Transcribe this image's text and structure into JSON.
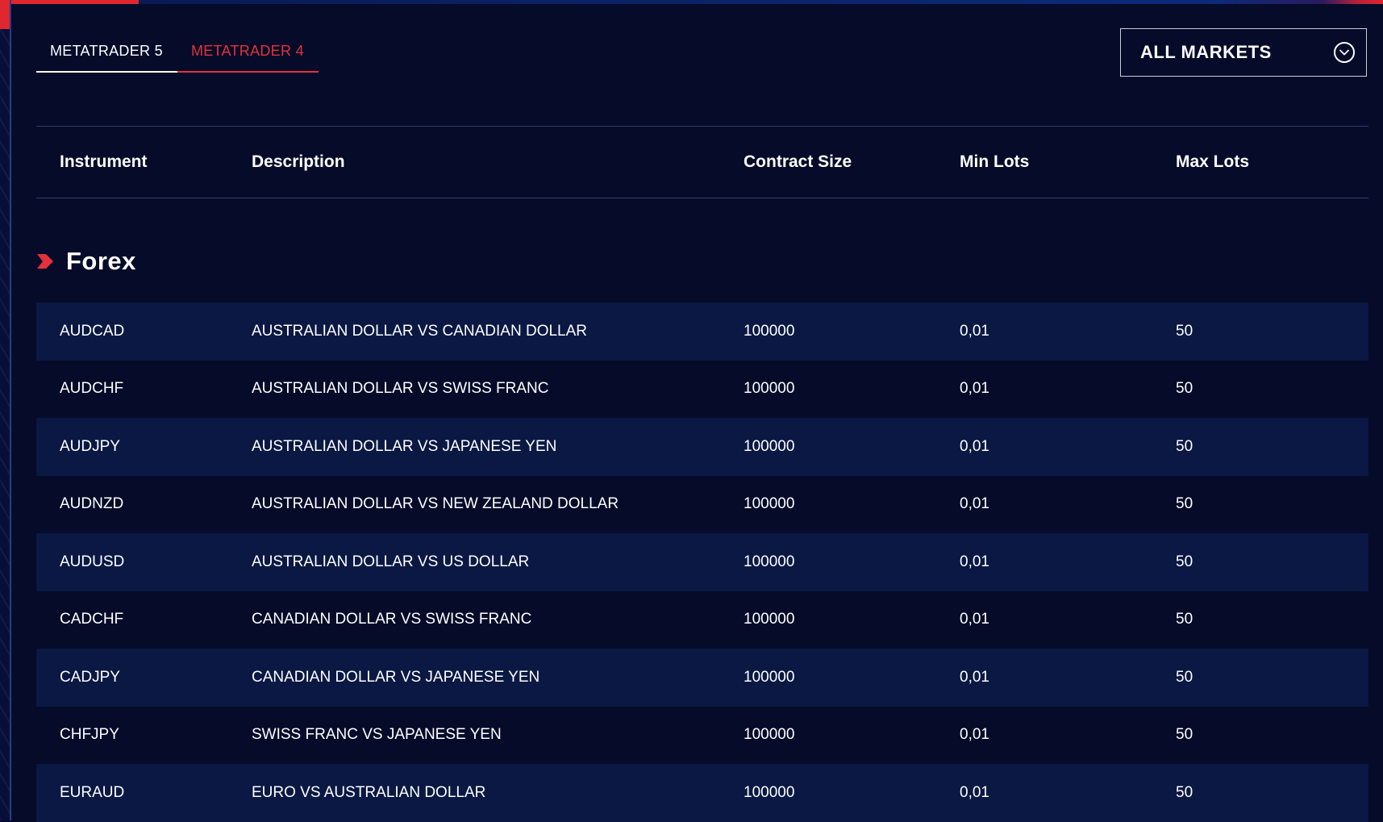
{
  "tabs": [
    {
      "label": "METATRADER 5",
      "active": true
    },
    {
      "label": "METATRADER 4",
      "active": false
    }
  ],
  "markets_dropdown": {
    "selected": "ALL MARKETS",
    "icon": "chevron-down-icon"
  },
  "table": {
    "headers": {
      "instrument": "Instrument",
      "description": "Description",
      "contract_size": "Contract Size",
      "min_lots": "Min Lots",
      "max_lots": "Max Lots"
    }
  },
  "section": {
    "title": "Forex",
    "icon": "arrow-right-icon"
  },
  "rows": [
    {
      "instrument": "AUDCAD",
      "description": "AUSTRALIAN DOLLAR VS CANADIAN DOLLAR",
      "contract_size": "100000",
      "min_lots": "0,01",
      "max_lots": "50"
    },
    {
      "instrument": "AUDCHF",
      "description": "AUSTRALIAN DOLLAR VS SWISS FRANC",
      "contract_size": "100000",
      "min_lots": "0,01",
      "max_lots": "50"
    },
    {
      "instrument": "AUDJPY",
      "description": "AUSTRALIAN DOLLAR VS JAPANESE YEN",
      "contract_size": "100000",
      "min_lots": "0,01",
      "max_lots": "50"
    },
    {
      "instrument": "AUDNZD",
      "description": "AUSTRALIAN DOLLAR VS NEW ZEALAND DOLLAR",
      "contract_size": "100000",
      "min_lots": "0,01",
      "max_lots": "50"
    },
    {
      "instrument": "AUDUSD",
      "description": "AUSTRALIAN DOLLAR VS US DOLLAR",
      "contract_size": "100000",
      "min_lots": "0,01",
      "max_lots": "50"
    },
    {
      "instrument": "CADCHF",
      "description": "CANADIAN DOLLAR VS SWISS FRANC",
      "contract_size": "100000",
      "min_lots": "0,01",
      "max_lots": "50"
    },
    {
      "instrument": "CADJPY",
      "description": "CANADIAN DOLLAR VS JAPANESE YEN",
      "contract_size": "100000",
      "min_lots": "0,01",
      "max_lots": "50"
    },
    {
      "instrument": "CHFJPY",
      "description": "SWISS FRANC VS JAPANESE YEN",
      "contract_size": "100000",
      "min_lots": "0,01",
      "max_lots": "50"
    },
    {
      "instrument": "EURAUD",
      "description": "EURO VS AUSTRALIAN DOLLAR",
      "contract_size": "100000",
      "min_lots": "0,01",
      "max_lots": "50"
    }
  ],
  "colors": {
    "background": "#050b29",
    "row_alt": "#0a1843",
    "accent": "#e4323a",
    "text": "#ffffff"
  }
}
